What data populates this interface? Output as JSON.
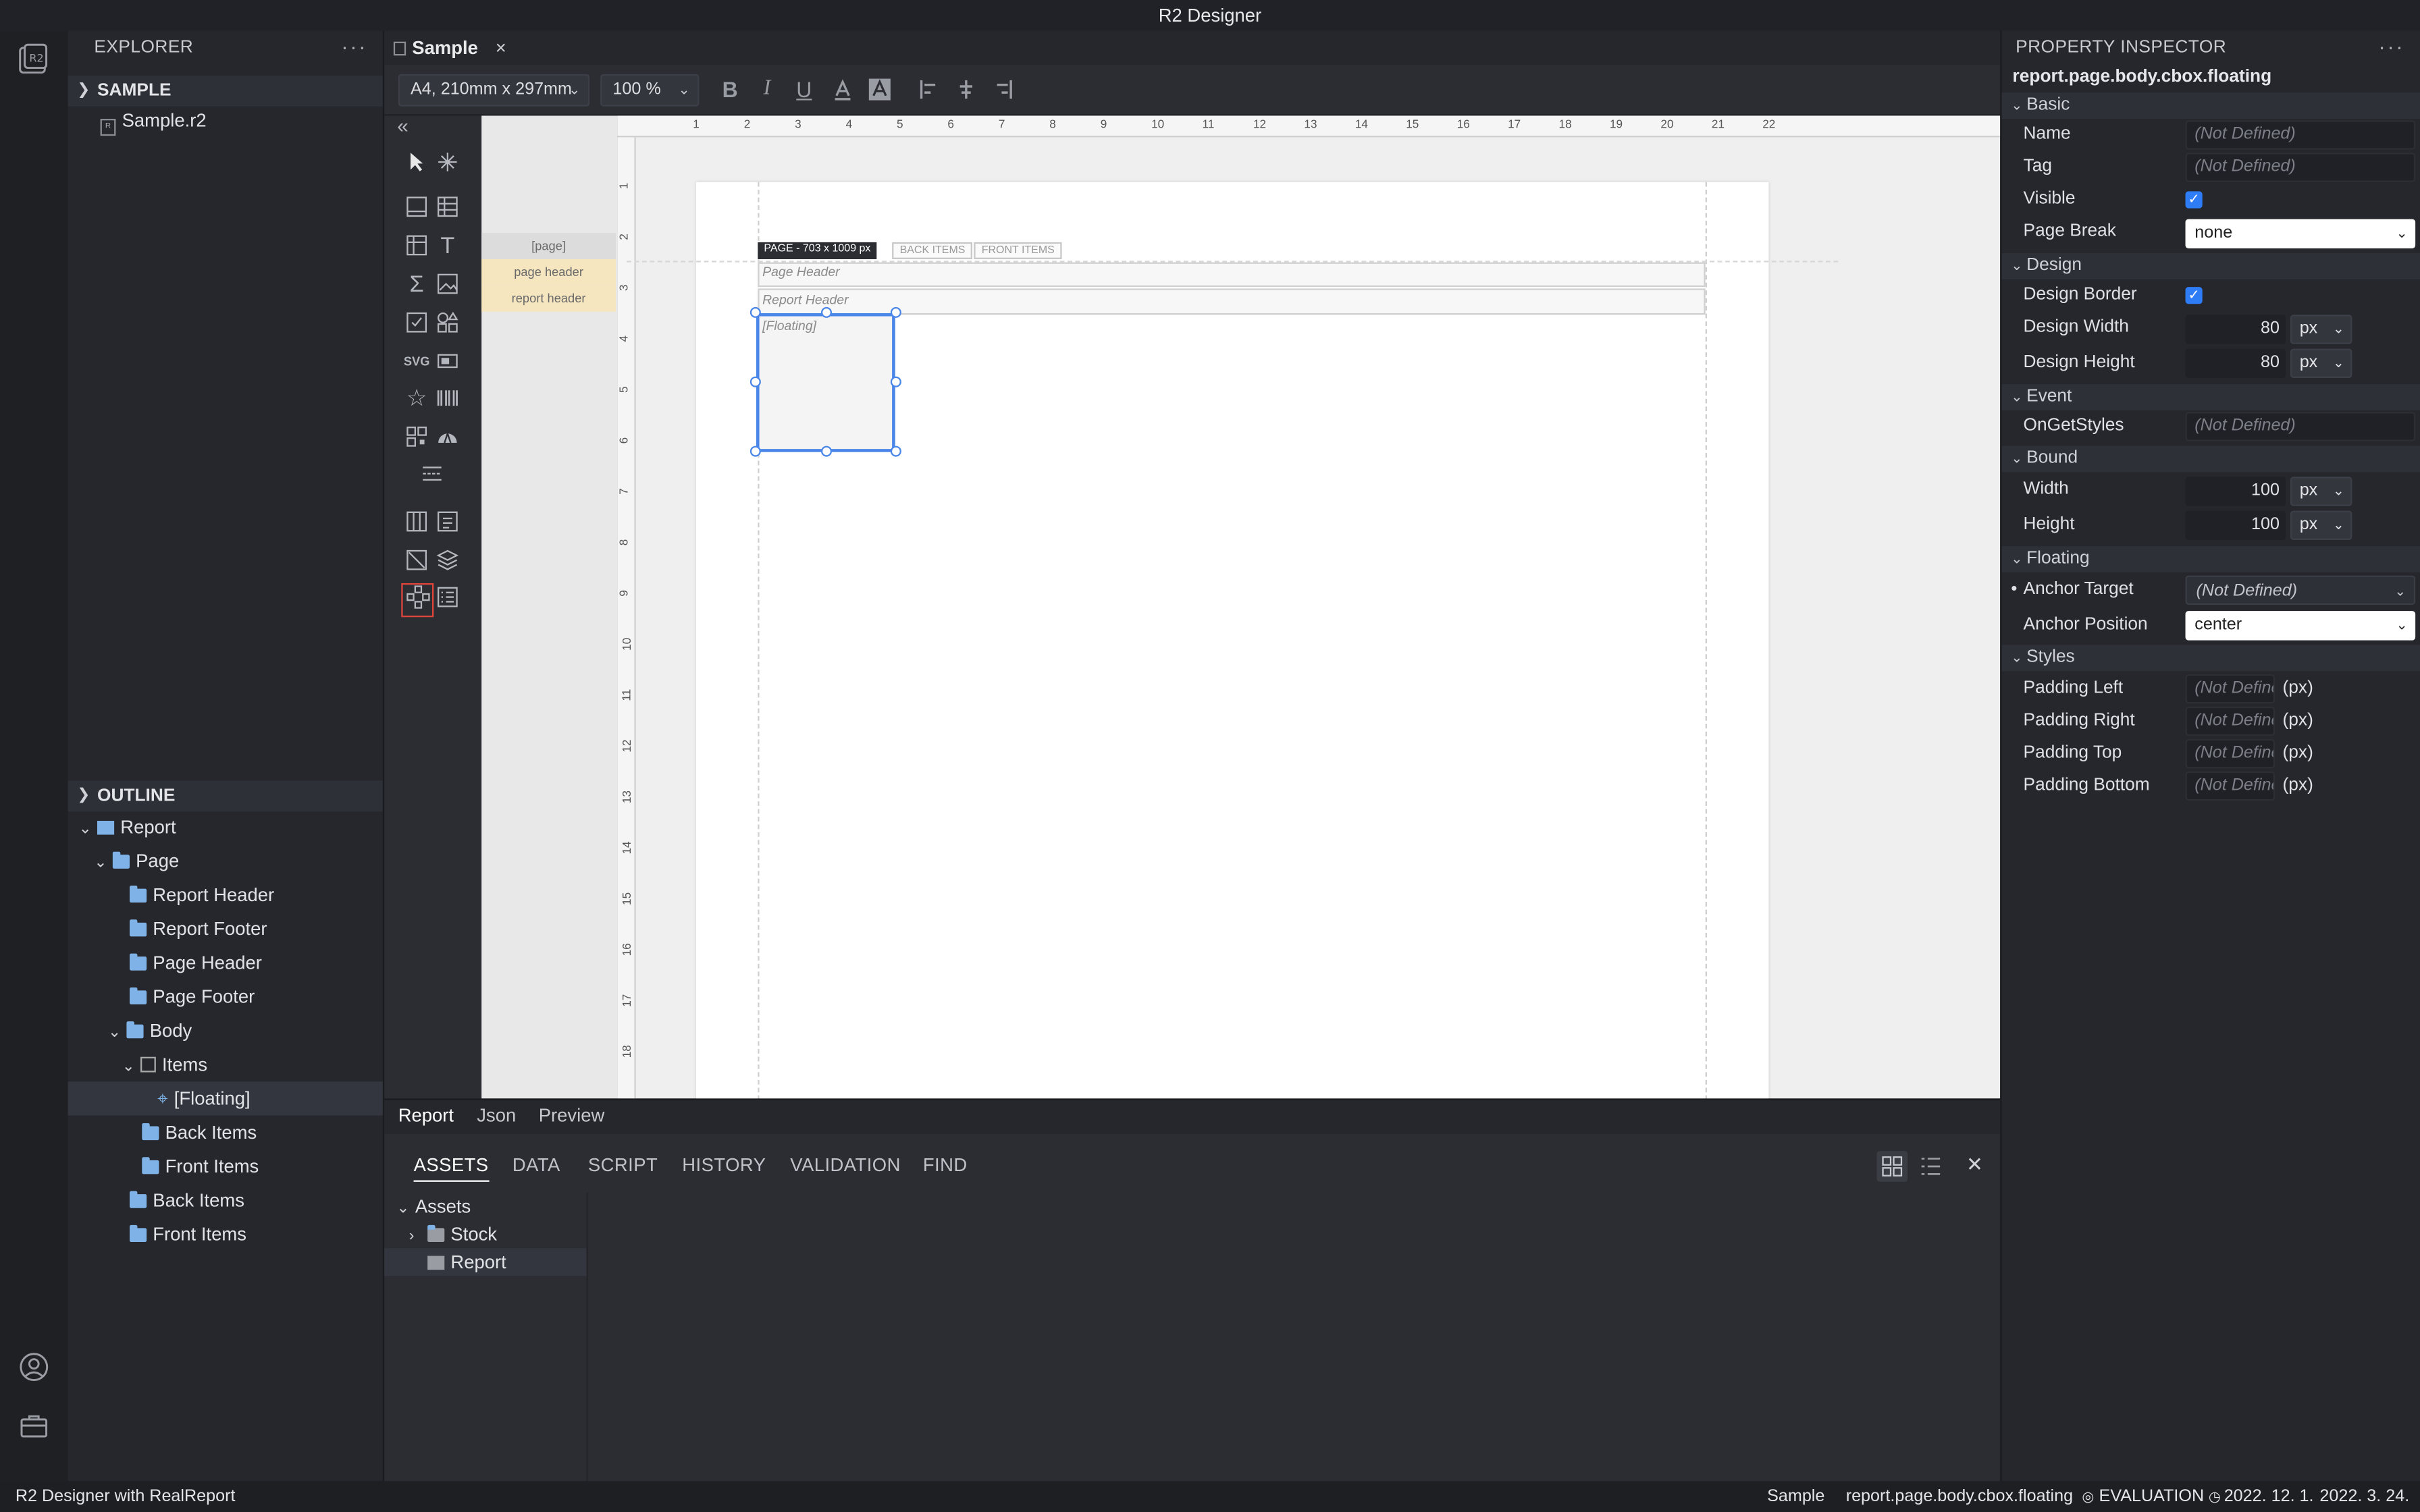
{
  "app_title": "R2 Designer",
  "explorer": {
    "title": "EXPLORER",
    "more": "···",
    "section": "SAMPLE",
    "file": "Sample.r2"
  },
  "outline": {
    "title": "OUTLINE",
    "items": [
      {
        "label": "Report"
      },
      {
        "label": "Page"
      },
      {
        "label": "Report Header"
      },
      {
        "label": "Report Footer"
      },
      {
        "label": "Page Header"
      },
      {
        "label": "Page Footer"
      },
      {
        "label": "Body"
      },
      {
        "label": "Items"
      },
      {
        "label": "[Floating]"
      },
      {
        "label": "Back Items"
      },
      {
        "label": "Front Items"
      },
      {
        "label": "Back Items"
      },
      {
        "label": "Front Items"
      }
    ]
  },
  "editor": {
    "tab": "Sample",
    "tab_close": "×",
    "paper_size": "A4, 210mm x 297mm",
    "zoom": "100 %",
    "format_buttons": {
      "bold": "B",
      "italic": "I",
      "underline": "U"
    },
    "collapse": "«"
  },
  "canvas": {
    "bands": [
      "[page]",
      "page header",
      "report header"
    ],
    "page_tag": "PAGE - 703 x 1009 px",
    "back_items": "BACK ITEMS",
    "front_items": "FRONT ITEMS",
    "page_header": "Page Header",
    "report_header": "Report Header",
    "floating": "[Floating]",
    "ruler_top": [
      "1",
      "2",
      "3",
      "4",
      "5",
      "6",
      "7",
      "8",
      "9",
      "10",
      "11",
      "12",
      "13",
      "14",
      "15",
      "16",
      "17",
      "18",
      "19",
      "20",
      "21",
      "22"
    ],
    "ruler_left": [
      "1",
      "2",
      "3",
      "4",
      "5",
      "6",
      "7",
      "8",
      "9",
      "10",
      "11",
      "12",
      "13",
      "14",
      "15",
      "16",
      "17",
      "18"
    ]
  },
  "view_tabs": [
    "Report",
    "Json",
    "Preview"
  ],
  "bottom": {
    "tabs": [
      "ASSETS",
      "DATA",
      "SCRIPT",
      "HISTORY",
      "VALIDATION",
      "FIND"
    ],
    "tree": {
      "root": "Assets",
      "stock": "Stock",
      "report": "Report"
    },
    "close": "✕"
  },
  "inspector": {
    "title": "PROPERTY INSPECTOR",
    "more": "···",
    "path": "report.page.body.cbox.floating",
    "sections": {
      "basic": "Basic",
      "design": "Design",
      "event": "Event",
      "bound": "Bound",
      "floating": "Floating",
      "styles": "Styles"
    },
    "props": {
      "name": {
        "label": "Name",
        "value": "(Not Defined)"
      },
      "tag": {
        "label": "Tag",
        "value": "(Not Defined)"
      },
      "visible": {
        "label": "Visible",
        "checked": true
      },
      "page_break": {
        "label": "Page Break",
        "value": "none"
      },
      "design_border": {
        "label": "Design Border",
        "checked": true
      },
      "design_width": {
        "label": "Design Width",
        "value": "80",
        "unit": "px"
      },
      "design_height": {
        "label": "Design Height",
        "value": "80",
        "unit": "px"
      },
      "on_get_styles": {
        "label": "OnGetStyles",
        "value": "(Not Defined)"
      },
      "width": {
        "label": "Width",
        "value": "100",
        "unit": "px"
      },
      "height": {
        "label": "Height",
        "value": "100",
        "unit": "px"
      },
      "anchor_target": {
        "label": "Anchor Target",
        "value": "(Not Defined)",
        "bullet": "•"
      },
      "anchor_position": {
        "label": "Anchor Position",
        "value": "center"
      },
      "padding_left": {
        "label": "Padding Left",
        "value": "(Not Define",
        "unit": "(px)"
      },
      "padding_right": {
        "label": "Padding Right",
        "value": "(Not Define",
        "unit": "(px)"
      },
      "padding_top": {
        "label": "Padding Top",
        "value": "(Not Define",
        "unit": "(px)"
      },
      "padding_bottom": {
        "label": "Padding Bottom",
        "value": "(Not Define",
        "unit": "(px)"
      }
    }
  },
  "statusbar": {
    "left": "R2 Designer with RealReport",
    "file": "Sample",
    "path": "report.page.body.cbox.floating",
    "license": "EVALUATION",
    "date1": "2022. 12. 1.",
    "date2": "2022. 3. 24."
  },
  "colors": {
    "accent": "#2e7cf6",
    "band_highlight": "#f5e6c0",
    "selection": "#4a86e8"
  }
}
